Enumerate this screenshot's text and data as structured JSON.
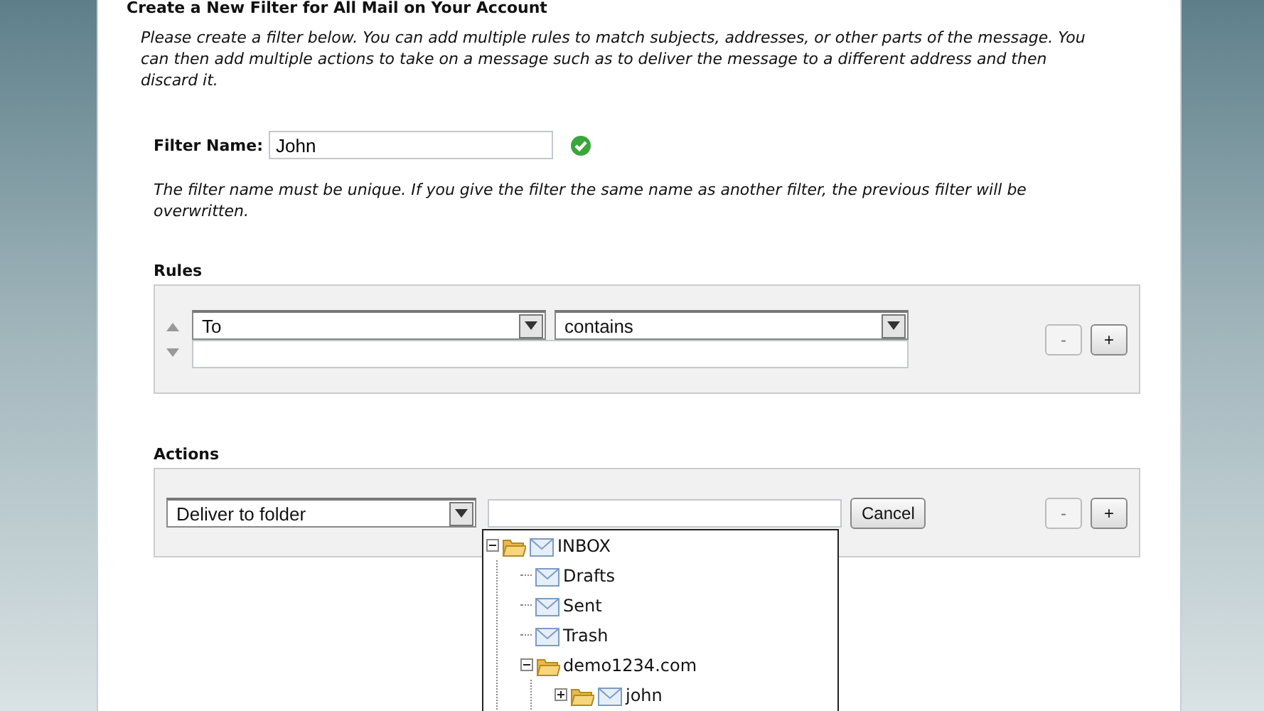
{
  "heading": "Create a New Filter for All Mail on Your Account",
  "intro": "Please create a filter below. You can add multiple rules to match subjects, addresses, or other parts of the message. You can then add multiple actions to take on a message such as to deliver the message to a different address and then discard it.",
  "filter_name": {
    "label": "Filter Name:",
    "value": "John",
    "valid": true
  },
  "name_note": "The filter name must be unique. If you give the filter the same name as another filter, the previous filter will be overwritten.",
  "rules": {
    "title": "Rules",
    "field": "To",
    "operator": "contains",
    "buttons": [
      {
        "label": "-",
        "disabled": true
      },
      {
        "label": "+",
        "disabled": false
      }
    ]
  },
  "actions": {
    "title": "Actions",
    "action": "Deliver to folder",
    "cancel": "Cancel",
    "buttons": [
      {
        "label": "-",
        "disabled": true
      },
      {
        "label": "+",
        "disabled": false
      }
    ],
    "folder_tree": [
      {
        "label": "INBOX",
        "kind": "both",
        "expanded": true,
        "children": [
          {
            "label": "Drafts",
            "kind": "mail"
          },
          {
            "label": "Sent",
            "kind": "mail"
          },
          {
            "label": "Trash",
            "kind": "mail"
          },
          {
            "label": "demo1234.com",
            "kind": "folder",
            "expanded": true,
            "children": [
              {
                "label": "john",
                "kind": "both",
                "expanded": false
              }
            ]
          }
        ]
      }
    ]
  }
}
